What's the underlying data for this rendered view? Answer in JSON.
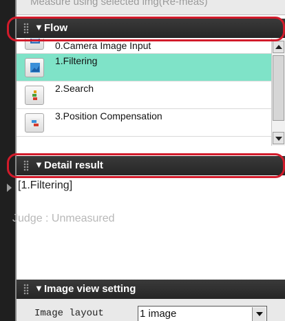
{
  "top_partial_text": "Measure using selected img(Re-meas)",
  "flow": {
    "header": "Flow",
    "items": [
      {
        "label": "0.Camera Image Input",
        "icon": "camera-icon",
        "selected": false
      },
      {
        "label": "1.Filtering",
        "icon": "filter-icon",
        "selected": true
      },
      {
        "label": "2.Search",
        "icon": "search-icon",
        "selected": false
      },
      {
        "label": "3.Position Compensation",
        "icon": "position-compensation-icon",
        "selected": false
      }
    ]
  },
  "detail": {
    "header": "Detail result",
    "title": "[1.Filtering]",
    "judge": "Judge : Unmeasured"
  },
  "image_view": {
    "header": "Image view setting",
    "layout_label": "Image layout",
    "layout_value": "1 image"
  },
  "colors": {
    "header_bg": "#2c2c2c",
    "highlight": "#d21b2b",
    "selected_row": "#7fe3c8"
  }
}
